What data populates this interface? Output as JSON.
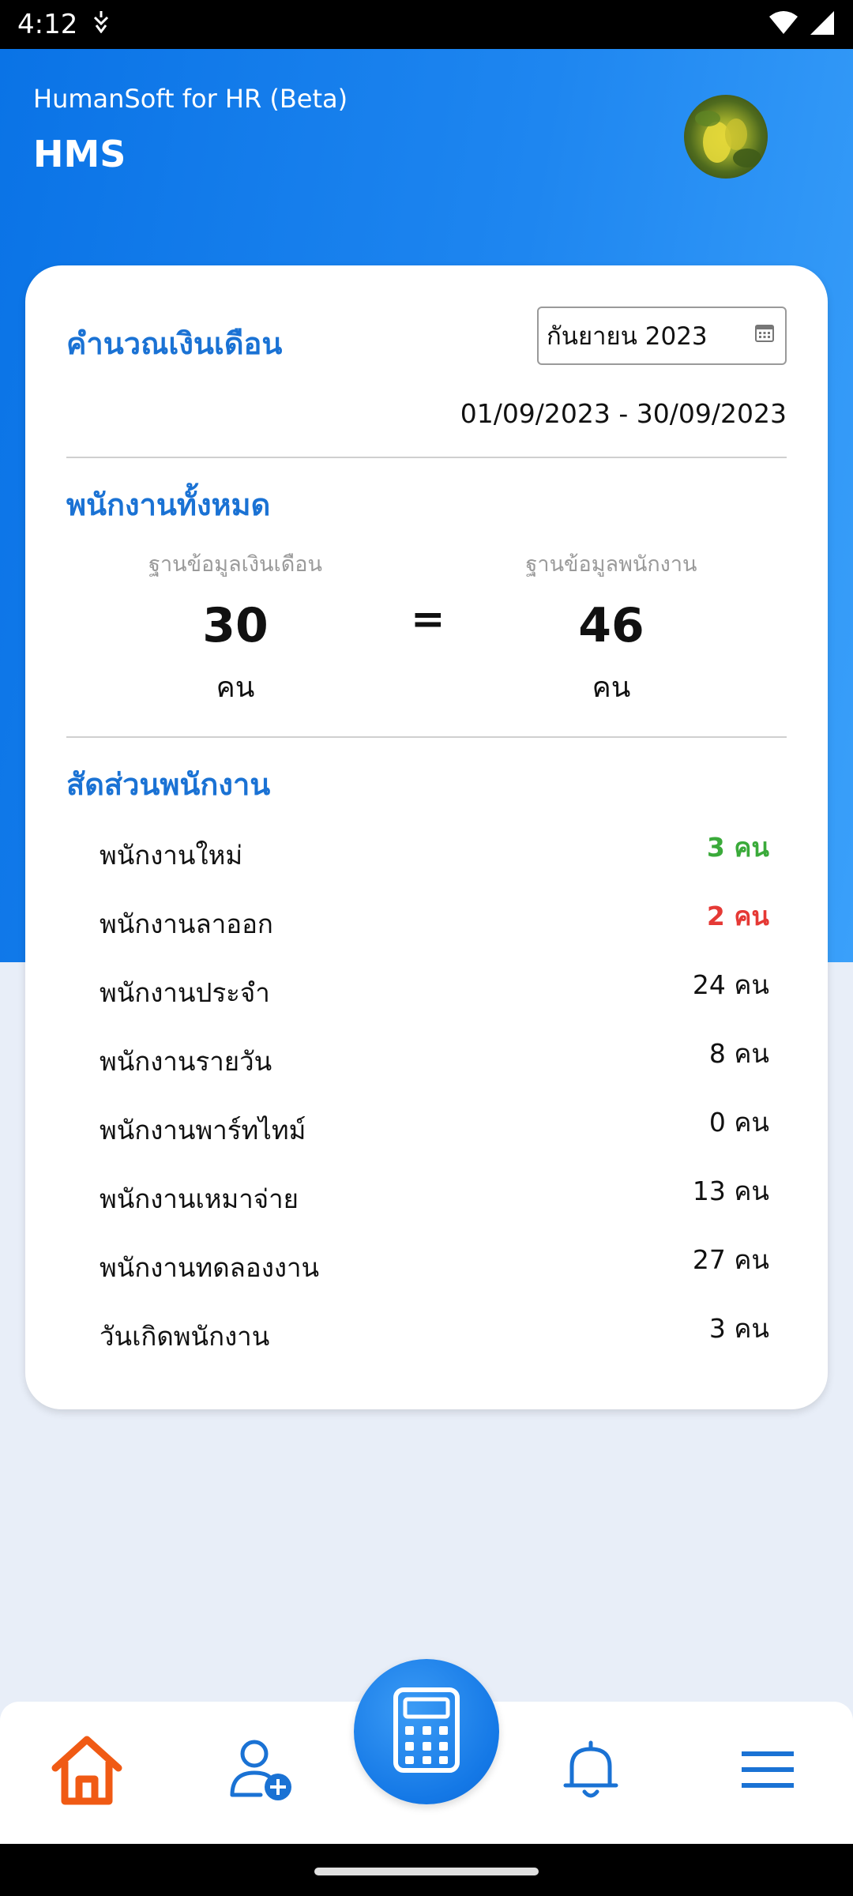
{
  "status_bar": {
    "time": "4:12"
  },
  "header": {
    "subtitle": "HumanSoft for HR (Beta)",
    "title": "HMS"
  },
  "salary": {
    "title": "คำนวณเงินเดือน",
    "month": "กันยายน 2023",
    "date_range": "01/09/2023 - 30/09/2023"
  },
  "all_employees": {
    "title": "พนักงานทั้งหมด",
    "left_label": "ฐานข้อมูลเงินเดือน",
    "left_value": "30",
    "left_unit": "คน",
    "equals": "=",
    "right_label": "ฐานข้อมูลพนักงาน",
    "right_value": "46",
    "right_unit": "คน"
  },
  "ratio": {
    "title": "สัดส่วนพนักงาน",
    "items": [
      {
        "label": "พนักงานใหม่",
        "value": "3 คน"
      },
      {
        "label": "พนักงานลาออก",
        "value": "2 คน"
      },
      {
        "label": "พนักงานประจำ",
        "value": "24 คน"
      },
      {
        "label": "พนักงานรายวัน",
        "value": "8 คน"
      },
      {
        "label": "พนักงานพาร์ทไทม์",
        "value": "0 คน"
      },
      {
        "label": "พนักงานเหมาจ่าย",
        "value": "13 คน"
      },
      {
        "label": "พนักงานทดลองงาน",
        "value": "27 คน"
      },
      {
        "label": "วันเกิดพนักงาน",
        "value": "3 คน"
      }
    ]
  },
  "colors": {
    "primary": "#1a72d4",
    "home_active": "#f05a14",
    "positive": "#3aaa3a",
    "negative": "#e53935"
  },
  "icons": [
    "wifi-icon",
    "signal-icon",
    "calendar-icon",
    "home-icon",
    "add-user-icon",
    "calculator-icon",
    "bell-icon",
    "menu-icon"
  ]
}
